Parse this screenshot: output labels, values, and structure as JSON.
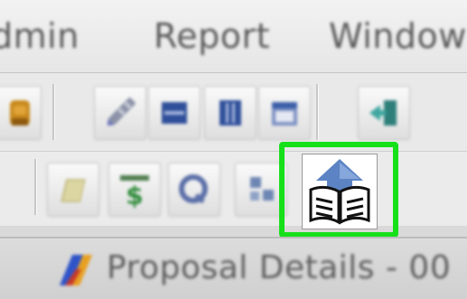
{
  "menu": {
    "items": [
      {
        "label": "dmin"
      },
      {
        "label": "Report"
      },
      {
        "label": "Window"
      }
    ]
  },
  "toolbar_row1": {
    "icons": [
      "user-icon",
      "pencil-icon",
      "list-icon",
      "columns-icon",
      "calendar-icon",
      "exit-icon"
    ]
  },
  "toolbar_row2": {
    "icons": [
      "folder-icon",
      "money-icon",
      "query-icon",
      "network-icon"
    ],
    "highlighted_icon": "open-book-upload-icon"
  },
  "window_bar": {
    "title": "Proposal Details - 00",
    "icon": "colored-logo-icon"
  },
  "colors": {
    "highlight": "#16e01a",
    "icon_blue": "#3b5ea8",
    "icon_gold": "#c98a1c",
    "icon_green": "#2e8b3a"
  }
}
